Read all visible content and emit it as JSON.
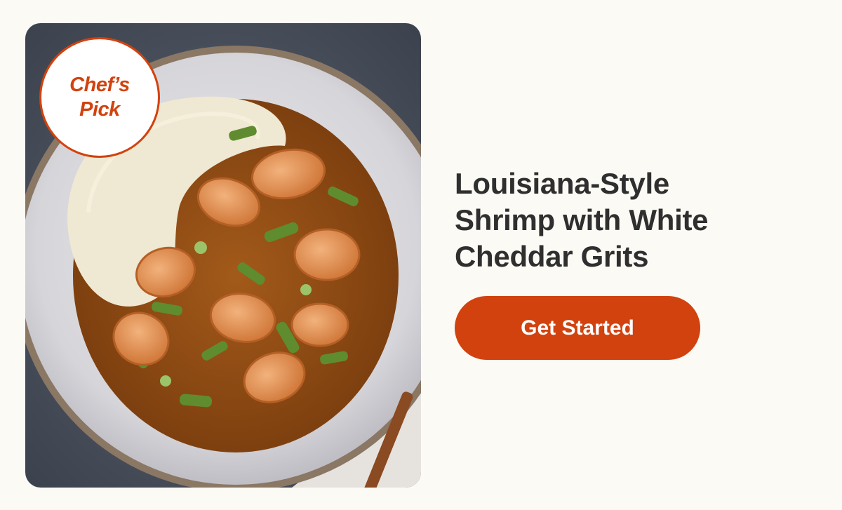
{
  "badge": {
    "text": "Chef’s Pick"
  },
  "recipe": {
    "title": "Louisiana-Style Shrimp with White Cheddar Grits"
  },
  "cta": {
    "label": "Get Started"
  },
  "colors": {
    "accent": "#d2420e",
    "background": "#fcfaf5",
    "title_text": "#2f2f2f"
  }
}
